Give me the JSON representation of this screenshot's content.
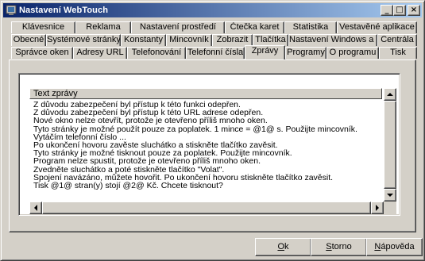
{
  "window": {
    "title": "Nastavení WebTouch",
    "controls": {
      "minimize": "_",
      "maximize": "□",
      "close": "×"
    }
  },
  "tabs": {
    "row1": [
      "Klávesnice",
      "Reklama",
      "Nastavení prostředí",
      "Čtečka karet",
      "Statistika",
      "Vestavěné aplikace"
    ],
    "row2": [
      "Obecné",
      "Systémové stránky",
      "Konstanty",
      "Mincovník",
      "Zobrazit",
      "Tlačítka",
      "Nastavení Windows a IE",
      "Centrála"
    ],
    "row3": [
      "Správce oken",
      "Adresy URL",
      "Telefonování",
      "Telefonní čísla",
      "Zprávy",
      "Programy",
      "O programu",
      "Tisk"
    ],
    "active": "Zprávy"
  },
  "list": {
    "column_header": "Text zprávy",
    "rows": [
      "Z důvodu zabezpečení byl přístup k této funkci odepřen.",
      "Z důvodu zabezpečení byl přístup k této URL adrese odepřen.",
      "Nové okno nelze otevřít, protože je otevřeno příliš mnoho oken.",
      "Tyto stránky je možné použít pouze za poplatek. 1 mince = @1@ s. Použijte mincovník.",
      "Vytáčím telefonní číslo ...",
      "Po ukončení hovoru zavěste sluchátko a stiskněte tlačítko zavěsit.",
      "Tyto stránky je možné tisknout pouze za poplatek. Použijte mincovník.",
      "Program nelze spustit, protože je otevřeno příliš mnoho oken.",
      "Zvedněte sluchátko a poté stiskněte tlačítko \"Volat\".",
      "Spojení navázáno, můžete hovořit. Po ukončení hovoru stiskněte tlačítko zavěsit.",
      "Tisk @1@ stran(y) stojí @2@ Kč. Chcete tisknout?"
    ]
  },
  "buttons": {
    "ok": {
      "hotkey": "O",
      "rest": "k"
    },
    "cancel": {
      "hotkey": "S",
      "rest": "torno"
    },
    "help": {
      "hotkey": "N",
      "rest": "ápověda"
    }
  }
}
